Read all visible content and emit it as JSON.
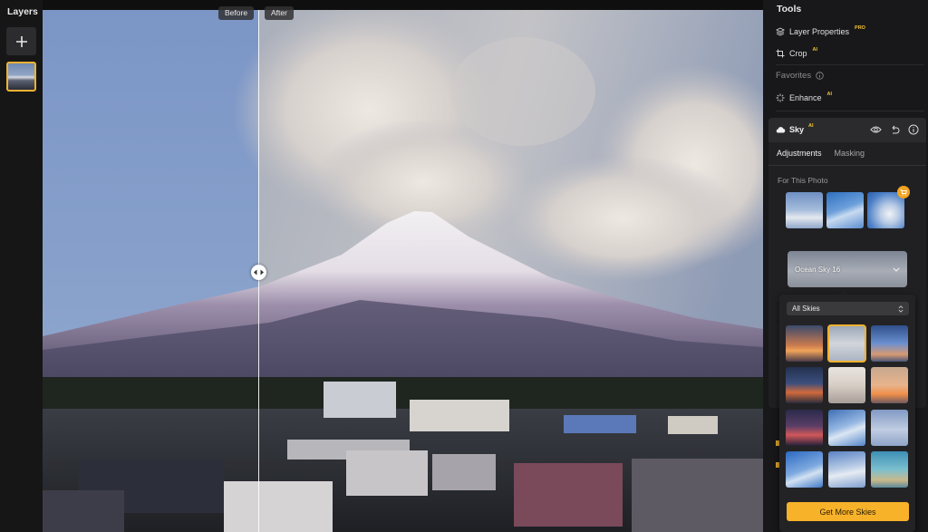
{
  "layers_panel": {
    "title": "Layers"
  },
  "canvas": {
    "before_label": "Before",
    "after_label": "After"
  },
  "tools_panel": {
    "title": "Tools",
    "items": [
      {
        "label": "Layer Properties",
        "badge": "PRO"
      },
      {
        "label": "Crop",
        "badge": "AI"
      }
    ],
    "favorites_label": "Favorites",
    "favorite_items": [
      {
        "label": "Enhance",
        "badge": "AI"
      }
    ]
  },
  "sky_tool": {
    "title": "Sky",
    "badge": "AI",
    "tabs": [
      "Adjustments",
      "Masking"
    ],
    "for_this_photo_label": "For This Photo",
    "selected_sky": "Ocean Sky 16"
  },
  "sky_picker": {
    "filter_value": "All Skies",
    "get_more_label": "Get More Skies",
    "selected_index": 1
  },
  "colors": {
    "accent": "#f2b12f",
    "panel_bg": "#18181a"
  }
}
